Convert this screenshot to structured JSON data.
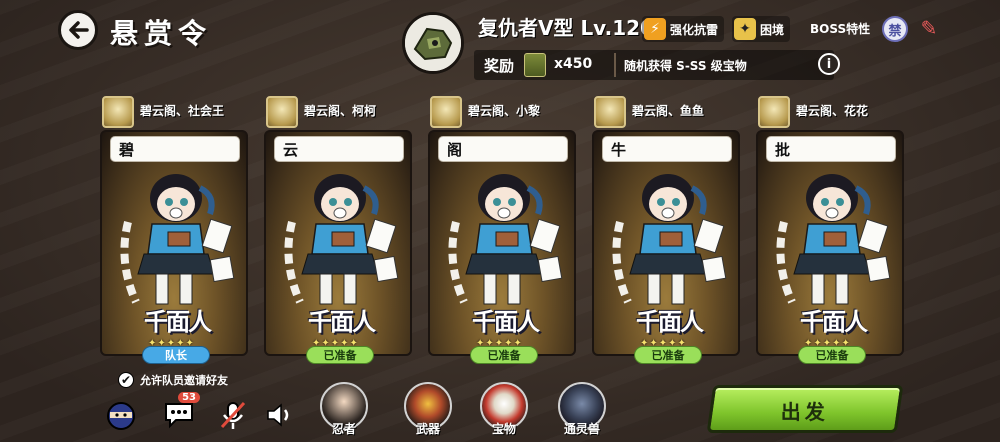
{
  "header": {
    "title": "悬赏令",
    "boss": {
      "name": "复仇者V型 Lv.120",
      "traits": [
        {
          "icon": "lightning-icon",
          "label": "强化抗雷",
          "color": "#f0a020"
        },
        {
          "icon": "trapped-icon",
          "label": "困境",
          "color": "#e8c24a"
        }
      ],
      "boss_traits_label": "BOSS特性",
      "seal_label": "禁"
    },
    "reward": {
      "label": "奖励",
      "count": "x450",
      "note": "随机获得 S-SS 级宝物",
      "info_label": "i"
    }
  },
  "cards": [
    {
      "player": "碧云阁、社会王",
      "speech": "碧",
      "status": "队长",
      "status_type": "leader"
    },
    {
      "player": "碧云阁、柯柯",
      "speech": "云",
      "status": "已准备",
      "status_type": "ready"
    },
    {
      "player": "碧云阁、小黎",
      "speech": "阁",
      "status": "已准备",
      "status_type": "ready"
    },
    {
      "player": "碧云阁、鱼鱼",
      "speech": "牛",
      "status": "已准备",
      "status_type": "ready"
    },
    {
      "player": "碧云阁、花花",
      "speech": "批",
      "status": "已准备",
      "status_type": "ready"
    }
  ],
  "card_logo": "千面人",
  "card_stars": "✦✦✦✦✦",
  "footer": {
    "allow_invite_label": "允许队员邀请好友",
    "chat_badge": "53",
    "tools": [
      {
        "label": "忍者"
      },
      {
        "label": "武器"
      },
      {
        "label": "宝物"
      },
      {
        "label": "通灵兽"
      }
    ],
    "go_label": "出发"
  }
}
